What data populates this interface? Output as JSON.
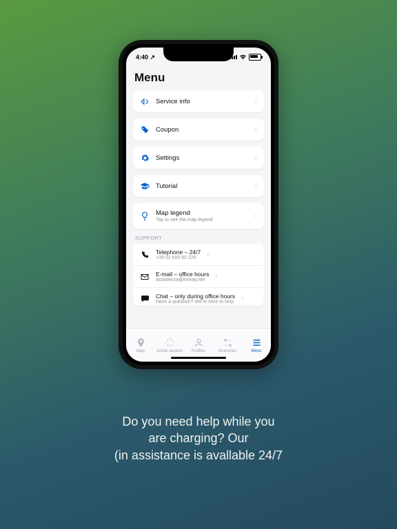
{
  "status": {
    "time": "4:40",
    "loc_arrow": "↗"
  },
  "page_title": "Menu",
  "items": [
    {
      "key": "service-info",
      "label": "Service info",
      "icon": "megaphone-icon"
    },
    {
      "key": "coupon",
      "label": "Coupon",
      "icon": "coupon-icon"
    },
    {
      "key": "settings",
      "label": "Settings",
      "icon": "gear-icon"
    },
    {
      "key": "tutorial",
      "label": "Tutorial",
      "icon": "graduation-cap-icon"
    },
    {
      "key": "map-legend",
      "label": "Map legend",
      "sub": "Tap to see the map legend",
      "icon": "lightbulb-icon"
    }
  ],
  "section_header": "SUPPORT",
  "support": [
    {
      "key": "telephone",
      "label": "Telephone – 24/7",
      "sub": "+39 02 600 60 220",
      "icon": "phone-icon"
    },
    {
      "key": "email",
      "label": "E-mail – office hours",
      "sub": "assistenza@evway.net",
      "icon": "envelope-icon"
    },
    {
      "key": "chat",
      "label": "Chat – only during office hours",
      "sub": "Have a question? We're here to help",
      "icon": "chat-icon"
    }
  ],
  "tabs": [
    {
      "key": "map",
      "label": "Map",
      "icon": "map-pin-icon"
    },
    {
      "key": "active",
      "label": "Active session",
      "icon": "spark-icon"
    },
    {
      "key": "profiles",
      "label": "Profiles",
      "icon": "user-icon"
    },
    {
      "key": "itineraries",
      "label": "Itineraries",
      "icon": "route-icon"
    },
    {
      "key": "menu",
      "label": "Menu",
      "icon": "menu-icon",
      "active": true
    }
  ],
  "caption": {
    "l1": "Do you need help while you",
    "l2": "are charging? Our",
    "l3": "(in assistance is avallable 24/7"
  },
  "colors": {
    "accent": "#0a63c9"
  }
}
